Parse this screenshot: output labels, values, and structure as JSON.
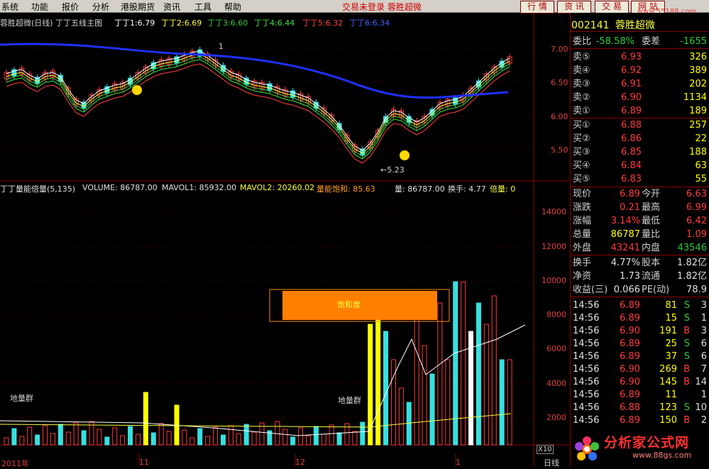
{
  "menu": [
    "系统",
    "功能",
    "报价",
    "分析",
    "港股期货",
    "资讯",
    "工具",
    "帮助"
  ],
  "status": "交易未登录  蓉胜超微",
  "toolbar": {
    "quote": "行 情",
    "news": "资 讯",
    "trade": "交 易",
    "web": "网 站"
  },
  "watermark_url": "www.55188.com",
  "chart_header": {
    "title": "蓉胜超微(日线) 丁丁五线主图",
    "d1_label": "丁丁1:",
    "d1": "6.79",
    "d2_label": "丁丁2:",
    "d2": "6.69",
    "d3_label": "丁丁3:",
    "d3": "6.60",
    "d4_label": "丁丁4:",
    "d4": "6.44",
    "d5_label": "丁丁5:",
    "d5": "6.32",
    "d6_label": "丁丁6:",
    "d6": "6.34"
  },
  "price_axis": [
    "7.00",
    "6.50",
    "6.00",
    "5.50"
  ],
  "annotations": {
    "low": "5.23",
    "peak_mark": "1"
  },
  "volume_header": {
    "name": "丁丁量能倍量(5,135)",
    "volume": "VOLUME: 86787.00",
    "mavol1": "MAVOL1: 85932.00",
    "mavol2": "MAVOL2: 20260.02",
    "sat": "量能饱和: 85.63",
    "qty": "量: 86787.00",
    "turn": "换手: 4.77",
    "mult": "倍量: 0"
  },
  "volume_axis": [
    "14000",
    "12000",
    "10000",
    "8000",
    "6000",
    "4000",
    "2000"
  ],
  "volume_labels": {
    "ground1": "地量群",
    "ground2": "地量群",
    "saturation": "饱和度",
    "x10": "X10"
  },
  "date_axis": [
    "2011年",
    "11",
    "12",
    "1"
  ],
  "period_tab": "日线",
  "stock": {
    "code": "002141",
    "name": "蓉胜超微"
  },
  "weibi": {
    "label": "委比",
    "value": "-58.58%",
    "diff_label": "委差",
    "diff": "-1655"
  },
  "sells": [
    {
      "label": "卖⑤",
      "price": "6.93",
      "vol": "326"
    },
    {
      "label": "卖④",
      "price": "6.92",
      "vol": "389"
    },
    {
      "label": "卖③",
      "price": "6.91",
      "vol": "202"
    },
    {
      "label": "卖②",
      "price": "6.90",
      "vol": "1134"
    },
    {
      "label": "卖①",
      "price": "6.89",
      "vol": "189"
    }
  ],
  "buys": [
    {
      "label": "买①",
      "price": "6.88",
      "vol": "257"
    },
    {
      "label": "买②",
      "price": "6.86",
      "vol": "22"
    },
    {
      "label": "买③",
      "price": "6.85",
      "vol": "188"
    },
    {
      "label": "买④",
      "price": "6.84",
      "vol": "63"
    },
    {
      "label": "买⑤",
      "price": "6.83",
      "vol": "55"
    }
  ],
  "quote": [
    {
      "l1": "现价",
      "v1": "6.89",
      "l2": "今开",
      "v2": "6.63",
      "c1": "red",
      "c2": "red"
    },
    {
      "l1": "涨跌",
      "v1": "0.21",
      "l2": "最高",
      "v2": "6.99",
      "c1": "red",
      "c2": "red"
    },
    {
      "l1": "涨幅",
      "v1": "3.14%",
      "l2": "最低",
      "v2": "6.42",
      "c1": "red",
      "c2": "red"
    },
    {
      "l1": "总量",
      "v1": "86787",
      "l2": "量比",
      "v2": "1.09",
      "c1": "yel",
      "c2": "red"
    },
    {
      "l1": "外盘",
      "v1": "43241",
      "l2": "内盘",
      "v2": "43546",
      "c1": "red",
      "c2": "green"
    }
  ],
  "fund": [
    {
      "l1": "换手",
      "v1": "4.77%",
      "l2": "股本",
      "v2": "1.82亿"
    },
    {
      "l1": "净资",
      "v1": "1.73",
      "l2": "流通",
      "v2": "1.82亿"
    },
    {
      "l1": "收益(三)",
      "v1": "0.066",
      "l2": "PE(动)",
      "v2": "78.9"
    }
  ],
  "ticks": [
    {
      "t": "14:56",
      "p": "6.89",
      "v": "81",
      "s": "S",
      "n": "3"
    },
    {
      "t": "14:56",
      "p": "6.89",
      "v": "15",
      "s": "S",
      "n": "1"
    },
    {
      "t": "14:56",
      "p": "6.90",
      "v": "191",
      "s": "B",
      "n": "3"
    },
    {
      "t": "14:56",
      "p": "6.89",
      "v": "25",
      "s": "S",
      "n": "6"
    },
    {
      "t": "14:56",
      "p": "6.89",
      "v": "37",
      "s": "S",
      "n": "6"
    },
    {
      "t": "14:56",
      "p": "6.90",
      "v": "269",
      "s": "B",
      "n": "7"
    },
    {
      "t": "14:56",
      "p": "6.90",
      "v": "145",
      "s": "B",
      "n": "14"
    },
    {
      "t": "14:56",
      "p": "6.89",
      "v": "11",
      "s": "",
      "n": "1"
    },
    {
      "t": "14:56",
      "p": "6.88",
      "v": "123",
      "s": "S",
      "n": "10"
    },
    {
      "t": "14:56",
      "p": "6.89",
      "v": "150",
      "s": "B",
      "n": "2"
    }
  ],
  "logo": {
    "cn": "分析家公式网",
    "url": "www.88gs.com"
  }
}
